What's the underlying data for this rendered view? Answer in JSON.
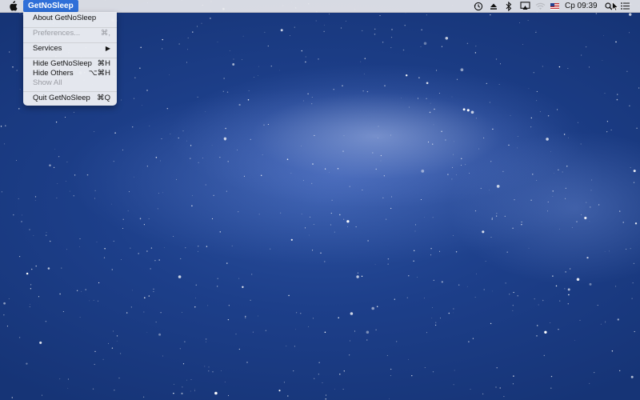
{
  "menubar": {
    "app_name": "GetNoSleep",
    "clock": "Cp 09:39",
    "status_icons": [
      "time-machine-icon",
      "eject-icon",
      "bluetooth-icon",
      "airplay-icon",
      "wifi-icon",
      "us-flag-icon",
      "spotlight-icon",
      "notification-center-icon"
    ]
  },
  "app_menu": {
    "items": [
      {
        "label": "About GetNoSleep",
        "shortcut": "",
        "enabled": true
      },
      {
        "label": "Preferences...",
        "shortcut": "⌘,",
        "enabled": false
      },
      {
        "label": "Services",
        "shortcut": "▶",
        "enabled": true
      },
      {
        "label": "Hide GetNoSleep",
        "shortcut": "⌘H",
        "enabled": true
      },
      {
        "label": "Hide Others",
        "shortcut": "⌥⌘H",
        "enabled": true
      },
      {
        "label": "Show All",
        "shortcut": "",
        "enabled": false
      },
      {
        "label": "Quit GetNoSleep",
        "shortcut": "⌘Q",
        "enabled": true
      }
    ]
  },
  "colors": {
    "menubar_bg": "#e8e8ec",
    "selection": "#2f6fd8",
    "disabled_text": "#9a9ca3"
  }
}
